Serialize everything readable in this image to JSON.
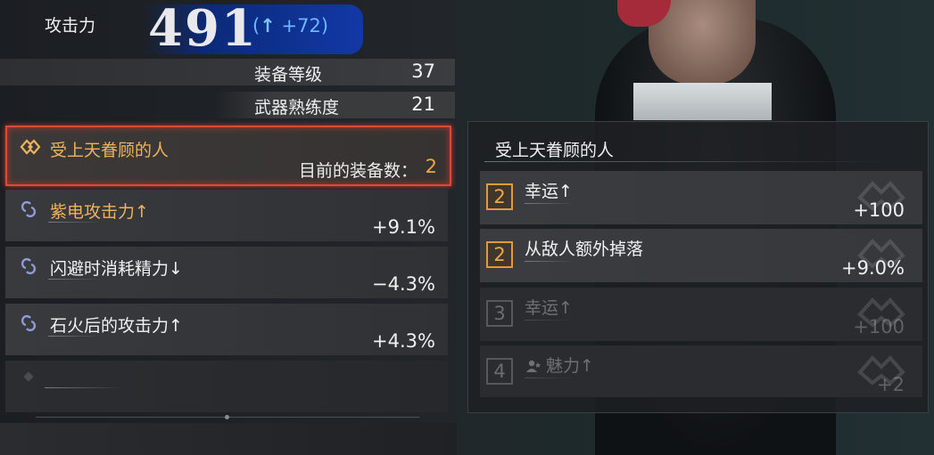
{
  "attack": {
    "label": "攻击力",
    "value": "491",
    "delta_arrow": "↑",
    "delta": "+72"
  },
  "stats": [
    {
      "label": "装备等级",
      "value": "37"
    },
    {
      "label": "武器熟练度",
      "value": "21"
    }
  ],
  "active_set": {
    "name": "受上天眷顾的人",
    "count_label": "目前的装备数：",
    "count": "2",
    "icon": "set-bond-icon"
  },
  "skills": [
    {
      "name": "紫电攻击力↑",
      "value": "+9.1%",
      "icon": "link-icon"
    },
    {
      "name": "闪避时消耗精力↓",
      "value": "−4.3%",
      "icon": "link-icon"
    },
    {
      "name": "石火后的攻击力↑",
      "value": "+4.3%",
      "icon": "link-icon"
    }
  ],
  "detail": {
    "title": "受上天眷顾的人",
    "bonuses": [
      {
        "tier": "2",
        "name": "幸运↑",
        "value": "+100",
        "active": true
      },
      {
        "tier": "2",
        "name": "从敌人额外掉落",
        "value": "+9.0%",
        "active": true
      },
      {
        "tier": "3",
        "name": "幸运↑",
        "value": "+100",
        "active": false
      },
      {
        "tier": "4",
        "name": "魅力↑",
        "value": "+2",
        "active": false,
        "icon": "charm-icon"
      }
    ]
  },
  "colors": {
    "accent_orange": "#f0a640",
    "highlight_red": "#d94a3a",
    "delta_blue": "#6fb6ff",
    "badge_blue": "#1238a6"
  }
}
